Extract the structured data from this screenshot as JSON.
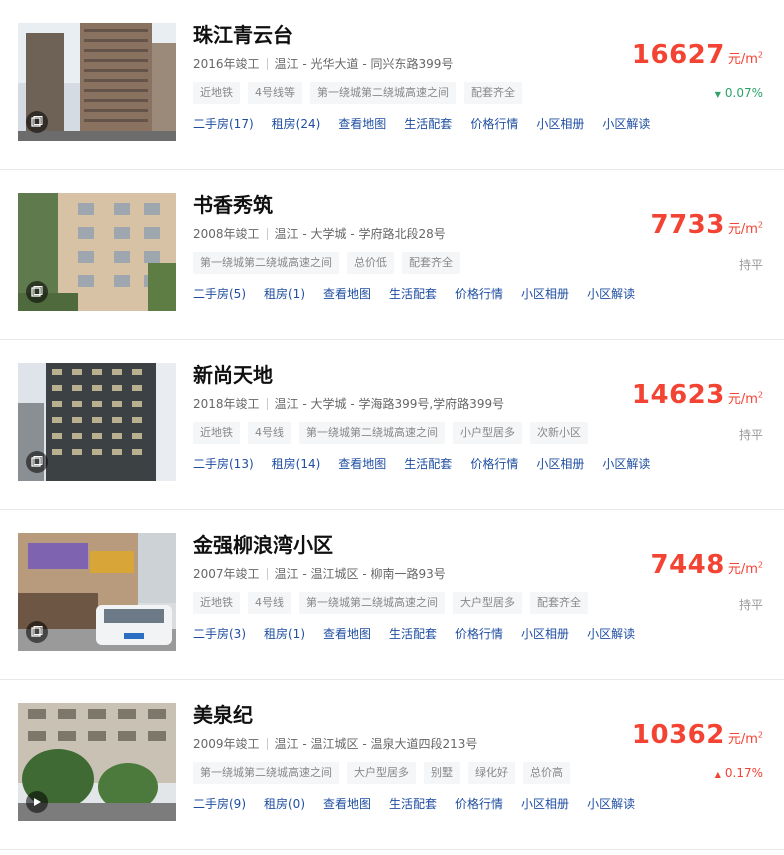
{
  "colors": {
    "price": "#f24333",
    "down": "#2ea36a",
    "up": "#f24333",
    "link": "#1f4ea1"
  },
  "listings": [
    {
      "name": "珠江青云台",
      "year": "2016年竣工",
      "location": "温江 - 光华大道 - 同兴东路399号",
      "tags": [
        "近地铁",
        "4号线等",
        "第一绕城第二绕城高速之间",
        "配套齐全"
      ],
      "links": [
        "二手房(17)",
        "租房(24)",
        "查看地图",
        "生活配套",
        "价格行情",
        "小区相册",
        "小区解读"
      ],
      "price": "16627",
      "unit": "元/m",
      "unit_sup": "2",
      "trend": "0.07%",
      "trend_dir": "down",
      "trend_arrow": "▼",
      "media_icon": "gallery-icon"
    },
    {
      "name": "书香秀筑",
      "year": "2008年竣工",
      "location": "温江 - 大学城 - 学府路北段28号",
      "tags": [
        "第一绕城第二绕城高速之间",
        "总价低",
        "配套齐全"
      ],
      "links": [
        "二手房(5)",
        "租房(1)",
        "查看地图",
        "生活配套",
        "价格行情",
        "小区相册",
        "小区解读"
      ],
      "price": "7733",
      "unit": "元/m",
      "unit_sup": "2",
      "trend": "持平",
      "trend_dir": "flat",
      "trend_arrow": "",
      "media_icon": "gallery-icon"
    },
    {
      "name": "新尚天地",
      "year": "2018年竣工",
      "location": "温江 - 大学城 - 学海路399号,学府路399号",
      "tags": [
        "近地铁",
        "4号线",
        "第一绕城第二绕城高速之间",
        "小户型居多",
        "次新小区"
      ],
      "links": [
        "二手房(13)",
        "租房(14)",
        "查看地图",
        "生活配套",
        "价格行情",
        "小区相册",
        "小区解读"
      ],
      "price": "14623",
      "unit": "元/m",
      "unit_sup": "2",
      "trend": "持平",
      "trend_dir": "flat",
      "trend_arrow": "",
      "media_icon": "gallery-icon"
    },
    {
      "name": "金强柳浪湾小区",
      "year": "2007年竣工",
      "location": "温江 - 温江城区 - 柳南一路93号",
      "tags": [
        "近地铁",
        "4号线",
        "第一绕城第二绕城高速之间",
        "大户型居多",
        "配套齐全"
      ],
      "links": [
        "二手房(3)",
        "租房(1)",
        "查看地图",
        "生活配套",
        "价格行情",
        "小区相册",
        "小区解读"
      ],
      "price": "7448",
      "unit": "元/m",
      "unit_sup": "2",
      "trend": "持平",
      "trend_dir": "flat",
      "trend_arrow": "",
      "media_icon": "gallery-icon"
    },
    {
      "name": "美泉纪",
      "year": "2009年竣工",
      "location": "温江 - 温江城区 - 温泉大道四段213号",
      "tags": [
        "第一绕城第二绕城高速之间",
        "大户型居多",
        "别墅",
        "绿化好",
        "总价高"
      ],
      "links": [
        "二手房(9)",
        "租房(0)",
        "查看地图",
        "生活配套",
        "价格行情",
        "小区相册",
        "小区解读"
      ],
      "price": "10362",
      "unit": "元/m",
      "unit_sup": "2",
      "trend": "0.17%",
      "trend_dir": "up",
      "trend_arrow": "▲",
      "media_icon": "video-play-icon"
    }
  ]
}
